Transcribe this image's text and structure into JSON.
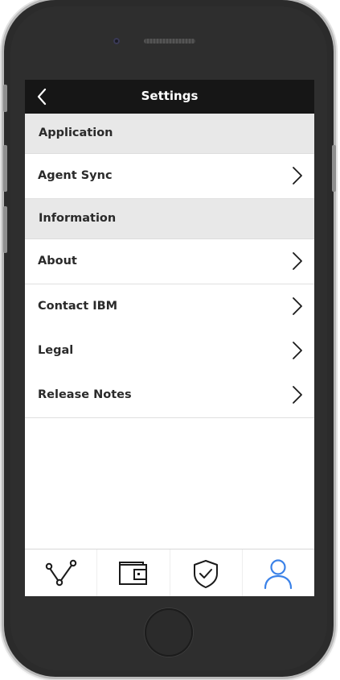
{
  "header": {
    "title": "Settings",
    "back_icon": "chevron-left-icon"
  },
  "sections": [
    {
      "title": "Application",
      "items": [
        {
          "label": "Agent Sync",
          "icon": "chevron-right-icon"
        }
      ]
    },
    {
      "title": "Information",
      "items": [
        {
          "label": "About",
          "icon": "chevron-right-icon"
        },
        {
          "label": "Contact IBM",
          "icon": "chevron-right-icon"
        },
        {
          "label": "Legal",
          "icon": "chevron-right-icon"
        },
        {
          "label": "Release Notes",
          "icon": "chevron-right-icon"
        }
      ]
    }
  ],
  "tabbar": {
    "tabs": [
      {
        "icon": "network-icon",
        "active": false
      },
      {
        "icon": "wallet-icon",
        "active": false
      },
      {
        "icon": "shield-check-icon",
        "active": false
      },
      {
        "icon": "user-icon",
        "active": true
      }
    ]
  },
  "colors": {
    "header_bg": "#161616",
    "section_bg": "#e8e8e8",
    "active_tab": "#3b82e8",
    "inactive_tab": "#1a1a1a"
  }
}
